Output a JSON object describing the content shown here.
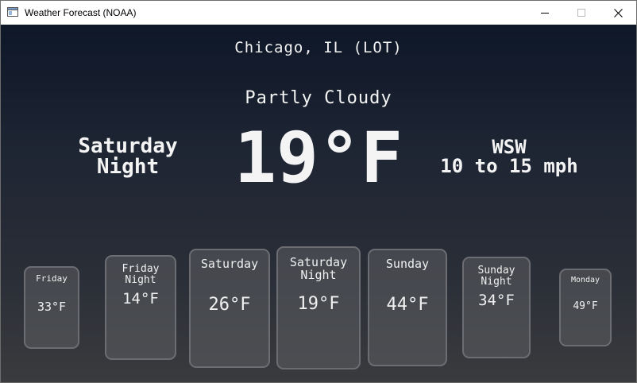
{
  "window": {
    "title": "Weather Forecast (NOAA)"
  },
  "current": {
    "location": "Chicago, IL (LOT)",
    "condition": "Partly Cloudy",
    "period_line1": "Saturday",
    "period_line2": "Night",
    "temperature": "19°F",
    "wind_direction": "WSW",
    "wind_speed": "10 to 15 mph"
  },
  "forecast": [
    {
      "name": "Friday",
      "temp": "33°F"
    },
    {
      "name": "Friday Night",
      "temp": "14°F"
    },
    {
      "name": "Saturday",
      "temp": "26°F"
    },
    {
      "name": "Saturday Night",
      "temp": "19°F"
    },
    {
      "name": "Sunday",
      "temp": "44°F"
    },
    {
      "name": "Sunday Night",
      "temp": "34°F"
    },
    {
      "name": "Monday",
      "temp": "49°F"
    }
  ]
}
